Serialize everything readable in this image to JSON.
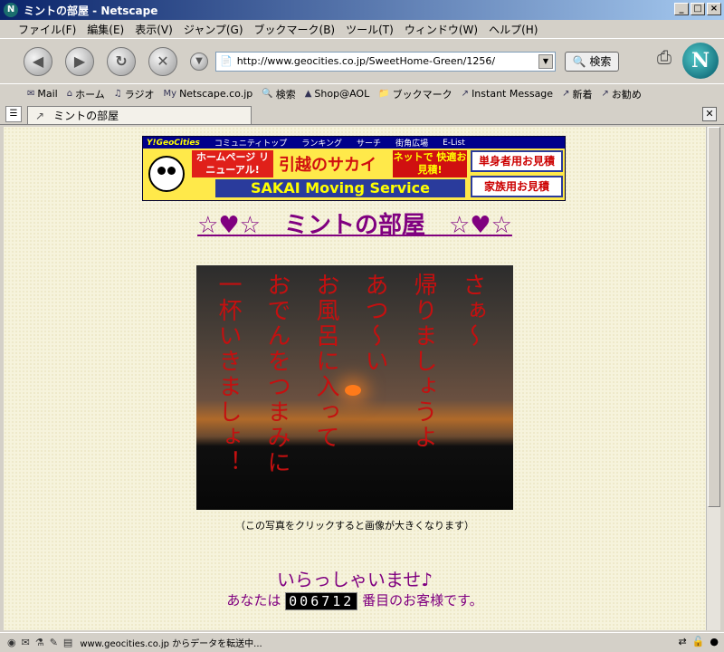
{
  "window": {
    "title": "ミントの部屋 - Netscape",
    "controls": [
      "_",
      "□",
      "×"
    ]
  },
  "menu": [
    "ファイル(F)",
    "編集(E)",
    "表示(V)",
    "ジャンプ(G)",
    "ブックマーク(B)",
    "ツール(T)",
    "ウィンドウ(W)",
    "ヘルプ(H)"
  ],
  "nav": {
    "url": "http://www.geocities.co.jp/SweetHome-Green/1256/",
    "search_label": "検索"
  },
  "personal_toolbar": [
    {
      "icon": "mail-icon",
      "label": "Mail"
    },
    {
      "icon": "home-icon",
      "label": "ホーム"
    },
    {
      "icon": "radio-icon",
      "label": "ラジオ"
    },
    {
      "icon": "my-icon",
      "label": "Netscape.co.jp"
    },
    {
      "icon": "search-icon",
      "label": "検索"
    },
    {
      "icon": "aol-icon",
      "label": "Shop@AOL"
    },
    {
      "icon": "folder-icon",
      "label": "ブックマーク"
    },
    {
      "icon": "link-icon",
      "label": "Instant Message"
    },
    {
      "icon": "link-icon",
      "label": "新着"
    },
    {
      "icon": "link-icon",
      "label": "お勧め"
    }
  ],
  "tab": {
    "label": "ミントの部屋"
  },
  "banner": {
    "top_items": [
      "Y!GeoCities",
      "コミュニティトップ",
      "ランキング",
      "サーチ",
      "街角広場",
      "E-List"
    ],
    "homepage_renewal": "ホームページ リニューアル!",
    "sakai": "引越のサカイ",
    "net_quote": "ネットで 快適お見積!",
    "single_quote": "単身者用お見積",
    "family_quote": "家族用お見積",
    "moving": "SAKAI Moving Service"
  },
  "page": {
    "title": "☆♥☆　ミントの部屋　☆♥☆",
    "poem_columns": [
      "さぁ〜",
      "帰りましょうよ",
      "あつ〜い",
      "お風呂に入って",
      "おでんをつまみに",
      "一杯いきましょ！"
    ],
    "caption": "（この写真をクリックすると画像が大きくなります）",
    "welcome": "いらっしゃいませ♪",
    "counter_prefix": "あなたは",
    "counter_value": "006712",
    "counter_suffix": "番目のお客様です。"
  },
  "status": {
    "text": "www.geocities.co.jp からデータを転送中..."
  },
  "colors": {
    "accent_purple": "#800080",
    "poem_red": "#c41010",
    "page_bg": "#f6f3dc"
  }
}
